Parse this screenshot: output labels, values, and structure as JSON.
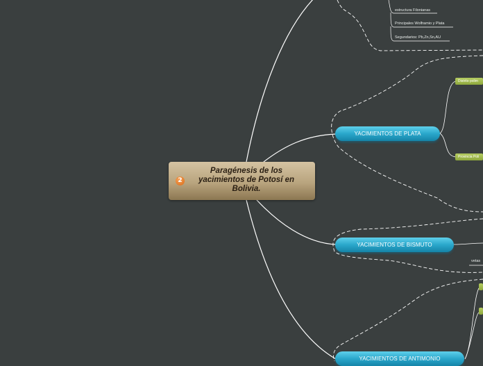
{
  "central": {
    "badge": "2",
    "title": "Paragénesis de los yacimientos de Potosí en Bolivia."
  },
  "topics": {
    "plata": "YACIMIENTOS DE PLATA",
    "bismuto": "YACIMIENTOS DE BISMUTO",
    "antimonio": "YACIMIENTOS DE ANTIMONIO"
  },
  "leaves": {
    "estructura": "estructura Filonianas",
    "principales": "Principales Wolframio y Plata",
    "secundarios": "Segundarios: Pb,Zn,Sn,AU",
    "vetas": "vetas"
  },
  "tags": {
    "distrito": "Distrito polim",
    "provincia": "Provincia Poli"
  },
  "colors": {
    "background": "#3a3f3f",
    "topic": "#2aa7cb",
    "tag": "#9db34a",
    "central": "#b9a47e",
    "connector": "#ffffff"
  }
}
